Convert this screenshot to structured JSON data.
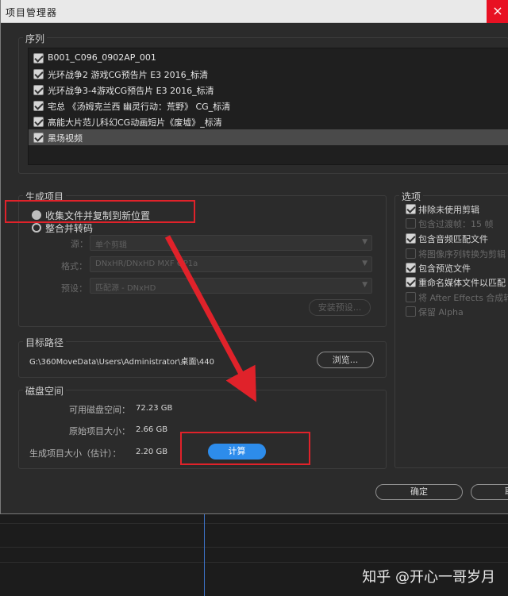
{
  "window": {
    "title": "项目管理器"
  },
  "sequence": {
    "label": "序列",
    "items": [
      {
        "label": "B001_C096_0902AP_001",
        "checked": true,
        "selected": false
      },
      {
        "label": "光环战争2 游戏CG预告片 E3 2016_标清",
        "checked": true,
        "selected": false
      },
      {
        "label": "光环战争3-4游戏CG预告片 E3 2016_标清",
        "checked": true,
        "selected": false
      },
      {
        "label": "宅总 《汤姆克兰西 幽灵行动：荒野》 CG_标清",
        "checked": true,
        "selected": false
      },
      {
        "label": "高能大片范儿科幻CG动画短片《废墟》_标清",
        "checked": true,
        "selected": false
      },
      {
        "label": "黑场视频",
        "checked": true,
        "selected": true
      }
    ]
  },
  "generate": {
    "label": "生成项目",
    "options": [
      {
        "label": "收集文件并复制到新位置",
        "selected": true
      },
      {
        "label": "整合并转码",
        "selected": false
      }
    ],
    "source_label": "源：",
    "source_value": "单个剪辑",
    "format_label": "格式：",
    "format_value": "DNxHR/DNxHD MXF OP1a",
    "preset_label": "预设：",
    "preset_value": "匹配源 - DNxHD",
    "install_preset_label": "安装预设..."
  },
  "options": {
    "label": "选项",
    "items": [
      {
        "label": "排除未使用剪辑",
        "checked": true,
        "enabled": true
      },
      {
        "label": "包含过渡帧：15 帧",
        "checked": false,
        "enabled": false
      },
      {
        "label": "包含音频匹配文件",
        "checked": true,
        "enabled": true
      },
      {
        "label": "将图像序列转换为剪辑",
        "checked": false,
        "enabled": false
      },
      {
        "label": "包含预览文件",
        "checked": true,
        "enabled": true
      },
      {
        "label": "重命名媒体文件以匹配",
        "checked": true,
        "enabled": true
      },
      {
        "label": "将 After Effects 合成转换",
        "checked": false,
        "enabled": false
      },
      {
        "label": "保留 Alpha",
        "checked": false,
        "enabled": false
      }
    ]
  },
  "destination": {
    "label": "目标路径",
    "path": "G:\\360MoveData\\Users\\Administrator\\桌面\\440",
    "browse_label": "浏览..."
  },
  "disk": {
    "label": "磁盘空间",
    "available_label": "可用磁盘空间：",
    "available_value": "72.23 GB",
    "original_label": "原始项目大小：",
    "original_value": "2.66 GB",
    "estimated_label": "生成项目大小（估计）：",
    "estimated_value": "2.20 GB",
    "calculate_label": "计算"
  },
  "buttons": {
    "ok_label": "确定",
    "cancel_label": "取"
  },
  "watermark": "知乎 @开心一哥岁月",
  "colors": {
    "accent": "#2d8ceb",
    "annotation": "#e0222a",
    "close": "#e81123"
  }
}
